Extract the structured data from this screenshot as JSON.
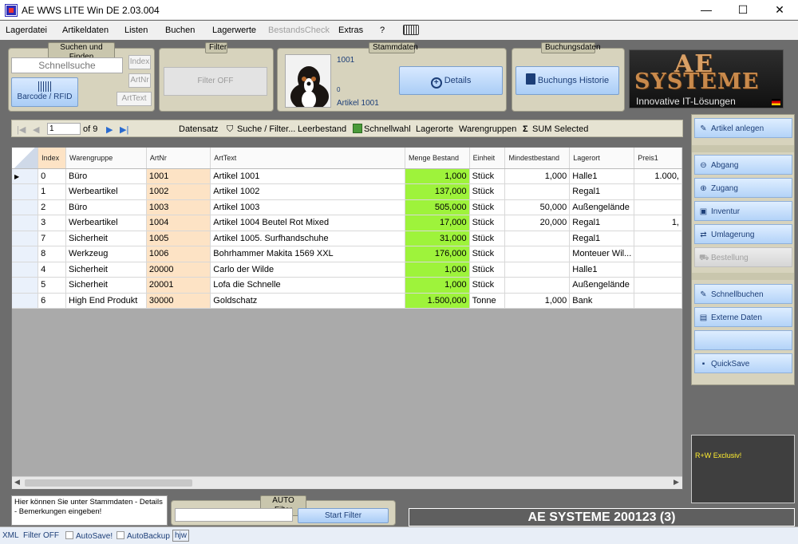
{
  "window": {
    "title": "AE WWS LITE Win DE 2.03.004",
    "min": "—",
    "max": "☐",
    "close": "✕"
  },
  "menu": [
    "Lagerdatei",
    "Artikeldaten",
    "Listen",
    "Buchen",
    "Lagerwerte",
    "BestandsCheck",
    "Extras",
    "?"
  ],
  "search": {
    "caption": "Suchen und Finden",
    "placeholder": "Schnellsuche",
    "barcode": "Barcode / RFID",
    "btn_index": "Index",
    "btn_artnr": "ArtNr",
    "btn_arttext": "ArtText"
  },
  "filter": {
    "caption": "Filter",
    "button": "Filter OFF"
  },
  "stammdaten": {
    "caption": "Stammdaten",
    "artnr": "1001",
    "zero": "0",
    "name": "Artikel 1001",
    "details": "Details"
  },
  "buchungsdaten": {
    "caption": "Buchungsdaten",
    "history": "Buchungs Historie"
  },
  "logo": {
    "line1": "AE",
    "line2": "SYSTEME",
    "tagline": "Innovative IT-Lösungen"
  },
  "toolbar": {
    "page": "1",
    "of": "of 9",
    "datensatz": "Datensatz",
    "suche": "Suche / Filter...",
    "leer": "Leerbestand",
    "schnellwahl": "Schnellwahl",
    "lagerorte": "Lagerorte",
    "warengruppen": "Warengruppen",
    "sum": "SUM Selected"
  },
  "grid": {
    "headers": [
      "Index",
      "Warengruppe",
      "ArtNr",
      "ArtText",
      "Menge Bestand",
      "Einheit",
      "Mindestbestand",
      "Lagerort",
      "Preis1"
    ],
    "rows": [
      [
        "0",
        "Büro",
        "1001",
        "Artikel 1001",
        "1,000",
        "Stück",
        "1,000",
        "Halle1",
        "1.000,"
      ],
      [
        "1",
        "Werbeartikel",
        "1002",
        "Artikel 1002",
        "137,000",
        "Stück",
        "",
        "Regal1",
        ""
      ],
      [
        "2",
        "Büro",
        "1003",
        "Artikel 1003",
        "505,000",
        "Stück",
        "50,000",
        "Außengelände",
        ""
      ],
      [
        "3",
        "Werbeartikel",
        "1004",
        "Artikel 1004 Beutel Rot Mixed",
        "17,000",
        "Stück",
        "20,000",
        "Regal1",
        "1,"
      ],
      [
        "7",
        "Sicherheit",
        "1005",
        "Artikel 1005. Surfhandschuhe",
        "31,000",
        "Stück",
        "",
        "Regal1",
        ""
      ],
      [
        "8",
        "Werkzeug",
        "1006",
        "Bohrhammer Makita 1569 XXL",
        "176,000",
        "Stück",
        "",
        "Monteuer Wil...",
        ""
      ],
      [
        "4",
        "Sicherheit",
        "20000",
        "Carlo der Wilde",
        "1,000",
        "Stück",
        "",
        "Halle1",
        ""
      ],
      [
        "5",
        "Sicherheit",
        "20001",
        "Lofa die Schnelle",
        "1,000",
        "Stück",
        "",
        "Außengelände",
        ""
      ],
      [
        "6",
        "High End Produkt",
        "30000",
        "Goldschatz",
        "1.500,000",
        "Tonne",
        "1,000",
        "Bank",
        ""
      ]
    ]
  },
  "right": {
    "anlegen": "Artikel anlegen",
    "abgang": "Abgang",
    "zugang": "Zugang",
    "inventur": "Inventur",
    "umlagerung": "Umlagerung",
    "bestellung": "Bestellung",
    "schnellbuchen": "Schnellbuchen",
    "extern": "Externe Daten",
    "quicksave": "QuickSave",
    "rw": "R+W Exclusiv!"
  },
  "bottom": {
    "hint": "Hier können Sie unter Stammdaten - Details - Bemerkungen eingeben!",
    "autofilter": "AUTO Filter",
    "start": "Start Filter",
    "company": "AE SYSTEME 200123 (3)"
  },
  "status": {
    "xml": "XML",
    "filter": "Filter OFF",
    "autosave": "AutoSave!",
    "autobackup": "AutoBackup",
    "user": "hjw"
  }
}
